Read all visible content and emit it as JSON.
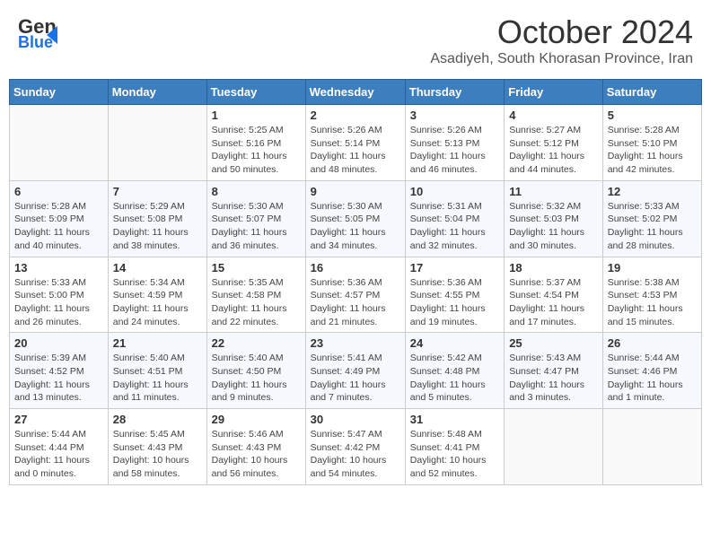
{
  "header": {
    "logo_line1": "General",
    "logo_line2": "Blue",
    "title": "October 2024",
    "subtitle": "Asadiyeh, South Khorasan Province, Iran"
  },
  "days_of_week": [
    "Sunday",
    "Monday",
    "Tuesday",
    "Wednesday",
    "Thursday",
    "Friday",
    "Saturday"
  ],
  "weeks": [
    [
      {
        "day": "",
        "info": ""
      },
      {
        "day": "",
        "info": ""
      },
      {
        "day": "1",
        "info": "Sunrise: 5:25 AM\nSunset: 5:16 PM\nDaylight: 11 hours and 50 minutes."
      },
      {
        "day": "2",
        "info": "Sunrise: 5:26 AM\nSunset: 5:14 PM\nDaylight: 11 hours and 48 minutes."
      },
      {
        "day": "3",
        "info": "Sunrise: 5:26 AM\nSunset: 5:13 PM\nDaylight: 11 hours and 46 minutes."
      },
      {
        "day": "4",
        "info": "Sunrise: 5:27 AM\nSunset: 5:12 PM\nDaylight: 11 hours and 44 minutes."
      },
      {
        "day": "5",
        "info": "Sunrise: 5:28 AM\nSunset: 5:10 PM\nDaylight: 11 hours and 42 minutes."
      }
    ],
    [
      {
        "day": "6",
        "info": "Sunrise: 5:28 AM\nSunset: 5:09 PM\nDaylight: 11 hours and 40 minutes."
      },
      {
        "day": "7",
        "info": "Sunrise: 5:29 AM\nSunset: 5:08 PM\nDaylight: 11 hours and 38 minutes."
      },
      {
        "day": "8",
        "info": "Sunrise: 5:30 AM\nSunset: 5:07 PM\nDaylight: 11 hours and 36 minutes."
      },
      {
        "day": "9",
        "info": "Sunrise: 5:30 AM\nSunset: 5:05 PM\nDaylight: 11 hours and 34 minutes."
      },
      {
        "day": "10",
        "info": "Sunrise: 5:31 AM\nSunset: 5:04 PM\nDaylight: 11 hours and 32 minutes."
      },
      {
        "day": "11",
        "info": "Sunrise: 5:32 AM\nSunset: 5:03 PM\nDaylight: 11 hours and 30 minutes."
      },
      {
        "day": "12",
        "info": "Sunrise: 5:33 AM\nSunset: 5:02 PM\nDaylight: 11 hours and 28 minutes."
      }
    ],
    [
      {
        "day": "13",
        "info": "Sunrise: 5:33 AM\nSunset: 5:00 PM\nDaylight: 11 hours and 26 minutes."
      },
      {
        "day": "14",
        "info": "Sunrise: 5:34 AM\nSunset: 4:59 PM\nDaylight: 11 hours and 24 minutes."
      },
      {
        "day": "15",
        "info": "Sunrise: 5:35 AM\nSunset: 4:58 PM\nDaylight: 11 hours and 22 minutes."
      },
      {
        "day": "16",
        "info": "Sunrise: 5:36 AM\nSunset: 4:57 PM\nDaylight: 11 hours and 21 minutes."
      },
      {
        "day": "17",
        "info": "Sunrise: 5:36 AM\nSunset: 4:55 PM\nDaylight: 11 hours and 19 minutes."
      },
      {
        "day": "18",
        "info": "Sunrise: 5:37 AM\nSunset: 4:54 PM\nDaylight: 11 hours and 17 minutes."
      },
      {
        "day": "19",
        "info": "Sunrise: 5:38 AM\nSunset: 4:53 PM\nDaylight: 11 hours and 15 minutes."
      }
    ],
    [
      {
        "day": "20",
        "info": "Sunrise: 5:39 AM\nSunset: 4:52 PM\nDaylight: 11 hours and 13 minutes."
      },
      {
        "day": "21",
        "info": "Sunrise: 5:40 AM\nSunset: 4:51 PM\nDaylight: 11 hours and 11 minutes."
      },
      {
        "day": "22",
        "info": "Sunrise: 5:40 AM\nSunset: 4:50 PM\nDaylight: 11 hours and 9 minutes."
      },
      {
        "day": "23",
        "info": "Sunrise: 5:41 AM\nSunset: 4:49 PM\nDaylight: 11 hours and 7 minutes."
      },
      {
        "day": "24",
        "info": "Sunrise: 5:42 AM\nSunset: 4:48 PM\nDaylight: 11 hours and 5 minutes."
      },
      {
        "day": "25",
        "info": "Sunrise: 5:43 AM\nSunset: 4:47 PM\nDaylight: 11 hours and 3 minutes."
      },
      {
        "day": "26",
        "info": "Sunrise: 5:44 AM\nSunset: 4:46 PM\nDaylight: 11 hours and 1 minute."
      }
    ],
    [
      {
        "day": "27",
        "info": "Sunrise: 5:44 AM\nSunset: 4:44 PM\nDaylight: 11 hours and 0 minutes."
      },
      {
        "day": "28",
        "info": "Sunrise: 5:45 AM\nSunset: 4:43 PM\nDaylight: 10 hours and 58 minutes."
      },
      {
        "day": "29",
        "info": "Sunrise: 5:46 AM\nSunset: 4:43 PM\nDaylight: 10 hours and 56 minutes."
      },
      {
        "day": "30",
        "info": "Sunrise: 5:47 AM\nSunset: 4:42 PM\nDaylight: 10 hours and 54 minutes."
      },
      {
        "day": "31",
        "info": "Sunrise: 5:48 AM\nSunset: 4:41 PM\nDaylight: 10 hours and 52 minutes."
      },
      {
        "day": "",
        "info": ""
      },
      {
        "day": "",
        "info": ""
      }
    ]
  ]
}
